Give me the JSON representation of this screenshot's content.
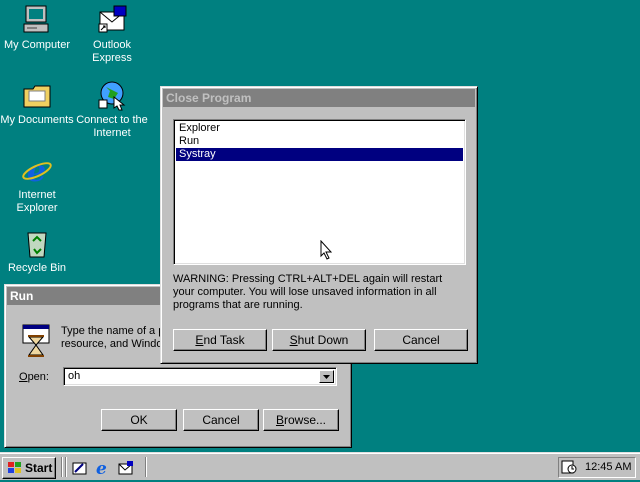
{
  "desktop": {
    "icons": [
      {
        "label_1": "My Computer",
        "label_2": ""
      },
      {
        "label_1": "Outlook",
        "label_2": "Express"
      },
      {
        "label_1": "My Documents",
        "label_2": ""
      },
      {
        "label_1": "Connect to the",
        "label_2": "Internet"
      },
      {
        "label_1": "Internet",
        "label_2": "Explorer"
      },
      {
        "label_1": "Recycle Bin",
        "label_2": ""
      }
    ]
  },
  "close_program": {
    "title": "Close Program",
    "processes": [
      "Explorer",
      "Run",
      "Systray"
    ],
    "selected_process": "Systray",
    "warning": "WARNING: Pressing CTRL+ALT+DEL again will restart your computer. You will lose unsaved information in all programs that are running.",
    "buttons": {
      "end_task_u": "E",
      "end_task_rest": "nd Task",
      "shut_down_u": "S",
      "shut_down_rest": "hut Down",
      "cancel": "Cancel"
    }
  },
  "run": {
    "title": "Run",
    "description_line1": "Type the name of a p",
    "description_line2": "resource, and Windo",
    "open_label_u": "O",
    "open_label_rest": "pen:",
    "open_value": "oh",
    "buttons": {
      "ok": "OK",
      "cancel": "Cancel",
      "browse_u": "B",
      "browse_rest": "rowse..."
    }
  },
  "taskbar": {
    "start_label": "Start",
    "clock": "12:45 AM"
  },
  "colors": {
    "desktop": "#008080",
    "active_title": "#000080",
    "inactive_title": "#808080",
    "face": "#c0c0c0"
  }
}
